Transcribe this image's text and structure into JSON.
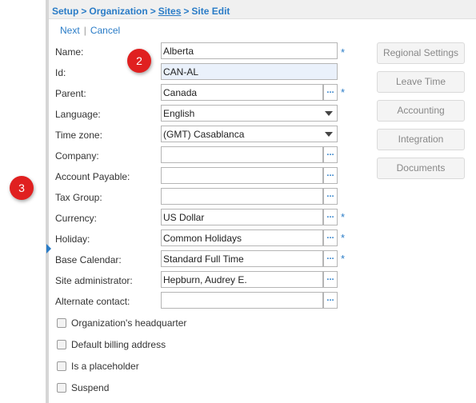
{
  "breadcrumb": {
    "setup": "Setup",
    "organization": "Organization",
    "sites": "Sites",
    "current": "Site Edit",
    "sep": ">"
  },
  "actions": {
    "next": "Next",
    "separator": "|",
    "cancel": "Cancel"
  },
  "form": {
    "name": {
      "label": "Name:",
      "value": "Alberta"
    },
    "id": {
      "label": "Id:",
      "value": "CAN-AL"
    },
    "parent": {
      "label": "Parent:",
      "value": "Canada"
    },
    "language": {
      "label": "Language:",
      "value": "English"
    },
    "timezone": {
      "label": "Time zone:",
      "value": "(GMT) Casablanca"
    },
    "company": {
      "label": "Company:",
      "value": ""
    },
    "account_payable": {
      "label": "Account Payable:",
      "value": ""
    },
    "tax_group": {
      "label": "Tax Group:",
      "value": ""
    },
    "currency": {
      "label": "Currency:",
      "value": "US Dollar"
    },
    "holiday": {
      "label": "Holiday:",
      "value": "Common Holidays"
    },
    "base_calendar": {
      "label": "Base Calendar:",
      "value": "Standard Full Time"
    },
    "site_administrator": {
      "label": "Site administrator:",
      "value": "Hepburn, Audrey E."
    },
    "alternate_contact": {
      "label": "Alternate contact:",
      "value": ""
    },
    "required_marker": "*",
    "lookup_glyph": "..."
  },
  "checkboxes": {
    "headquarter": "Organization's headquarter",
    "billing": "Default billing address",
    "placeholder": "Is a placeholder",
    "suspend": "Suspend"
  },
  "side_buttons": {
    "regional": "Regional Settings",
    "leave": "Leave Time",
    "accounting": "Accounting",
    "integration": "Integration",
    "documents": "Documents"
  },
  "badges": {
    "step2": "2",
    "step3": "3"
  },
  "colors": {
    "link": "#2a7cc7",
    "badge": "#e02020",
    "highlight": "#eaf1fb"
  }
}
